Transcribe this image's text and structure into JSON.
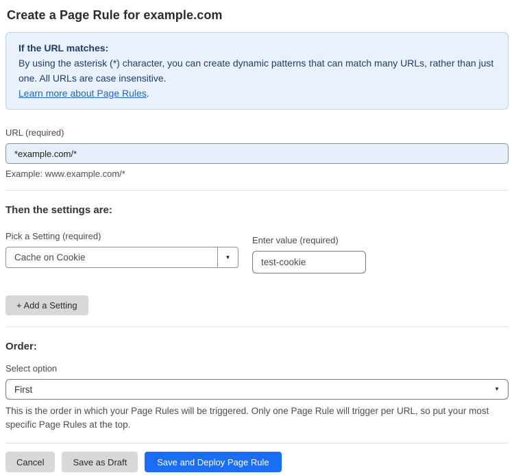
{
  "title": "Create a Page Rule for example.com",
  "info_box": {
    "heading": "If the URL matches:",
    "body": "By using the asterisk (*) character, you can create dynamic patterns that can match many URLs, rather than just one. All URLs are case insensitive.",
    "link_label": "Learn more about Page Rules",
    "link_suffix": "."
  },
  "url_field": {
    "label": "URL (required)",
    "value": "*example.com/*",
    "helper": "Example: www.example.com/*"
  },
  "settings": {
    "heading": "Then the settings are:",
    "picker": {
      "label": "Pick a Setting (required)",
      "value": "Cache on Cookie"
    },
    "value_field": {
      "label": "Enter value (required)",
      "value": "test-cookie"
    },
    "add_button_label": "+ Add a Setting"
  },
  "order": {
    "heading": "Order:",
    "select_label": "Select option",
    "selected_option": "First",
    "helper": "This is the order in which your Page Rules will be triggered. Only one Page Rule will trigger per URL, so put your most specific Page Rules at the top."
  },
  "actions": {
    "cancel": "Cancel",
    "save_draft": "Save as Draft",
    "save_deploy": "Save and Deploy Page Rule"
  },
  "icons": {
    "caret_down": "▼"
  },
  "colors": {
    "info_bg": "#e9f2fc",
    "info_border": "#b8d4f0",
    "info_text": "#1e3c6e",
    "link": "#2563c4",
    "url_input_bg": "#e8f0fe",
    "primary_button": "#1a6ef5",
    "gray_button": "#d8d8d8"
  }
}
